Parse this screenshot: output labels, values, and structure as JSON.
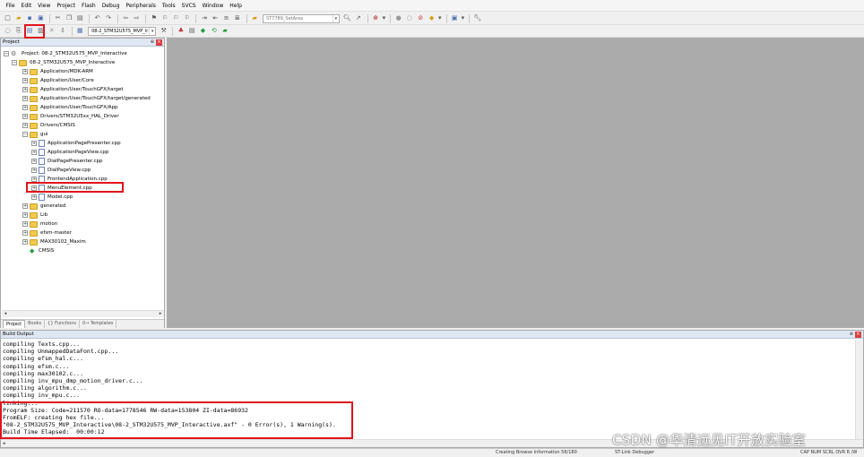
{
  "menu": [
    "File",
    "Edit",
    "View",
    "Project",
    "Flash",
    "Debug",
    "Peripherals",
    "Tools",
    "SVCS",
    "Window",
    "Help"
  ],
  "toolbar": {
    "find_combo": "ST7789_SetArea",
    "target_combo": "08-2_STM32U575_MVP_Ir"
  },
  "project_panel": {
    "title": "Project",
    "root": "Project: 08-2_STM32U575_MVP_Interactive",
    "target": "08-2_STM32U575_MVP_Interactive",
    "groups": [
      "Application/MDK-ARM",
      "Application/User/Core",
      "Application/User/TouchGFX/target",
      "Application/User/TouchGFX/target/generated",
      "Application/User/TouchGFX/App",
      "Drivers/STM32U5xx_HAL_Driver",
      "Drivers/CMSIS",
      "gui"
    ],
    "gui_files": [
      "ApplicationPagePresenter.cpp",
      "ApplicationPageView.cpp",
      "DialPagePresenter.cpp",
      "DialPageView.cpp",
      "FrontendApplication.cpp",
      "MenuElement.cpp",
      "Model.cpp"
    ],
    "more_groups": [
      "generated",
      "Lib",
      "motion",
      "efsm-master",
      "MAX30102_Maxim"
    ],
    "cmsis": "CMSIS",
    "tabs": [
      "Project",
      "Books",
      "{} Functions",
      "0→ Templates"
    ]
  },
  "build_output": {
    "title": "Build Output",
    "lines": [
      "compiling Texts.cpp...",
      "compiling UnmappedDataFont.cpp...",
      "compiling efsm_hal.c...",
      "compiling efsm.c...",
      "compiling max30102.c...",
      "compiling inv_mpu_dmp_motion_driver.c...",
      "compiling algorithm.c...",
      "compiling inv_mpu.c...",
      "linking...",
      "Program Size: Code=211570 RO-data=1778546 RW-data=153804 ZI-data=86932",
      "FromELF: creating hex file...",
      "\"08-2_STM32U575_MVP_Interactive\\08-2_STM32U575_MVP_Interactive.axf\" - 0 Error(s), 1 Warning(s).",
      "Build Time Elapsed:  00:00:12"
    ]
  },
  "status": {
    "browse": "Creating Browse Information 56/180",
    "debugger": "ST-Link Debugger",
    "flags": "CAP  NUM  SCRL  OVR  R /W"
  },
  "watermark": "CSDN @华清远见IT开放实验室"
}
